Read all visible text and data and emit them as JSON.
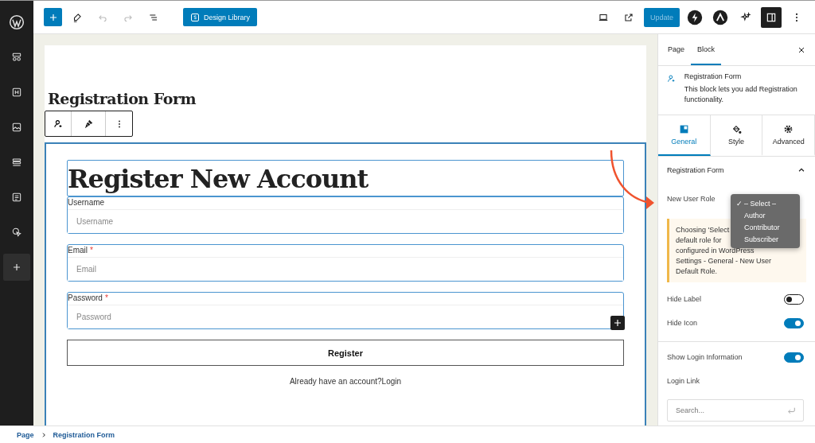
{
  "toolbar": {
    "design_library": "Design Library",
    "update": "Update"
  },
  "sidebar_items": [
    {
      "selected": false
    },
    {
      "selected": false
    },
    {
      "selected": false
    },
    {
      "selected": false
    },
    {
      "selected": false
    },
    {
      "selected": false
    },
    {
      "selected": false
    },
    {
      "selected": true
    }
  ],
  "canvas": {
    "page_title": "Registration Form",
    "heading": "Register New Account",
    "fields": [
      {
        "label": "Username",
        "placeholder": "Username"
      },
      {
        "label": "Email",
        "mark": "*",
        "placeholder": "Email"
      },
      {
        "label": "Password",
        "mark": "*",
        "placeholder": "Password"
      }
    ],
    "button": "Register",
    "login_prompt": "Already have an account?Login"
  },
  "breadcrumb": [
    "Page",
    "Registration Form"
  ],
  "panel": {
    "tabs": [
      {
        "label": "Page",
        "selected": false
      },
      {
        "label": "Block",
        "selected": true
      }
    ],
    "block": {
      "title": "Registration Form",
      "description": "This block lets you add Registration functionality."
    },
    "subtabs": [
      {
        "label": "General",
        "selected": true
      },
      {
        "label": "Style",
        "selected": false
      },
      {
        "label": "Advanced",
        "selected": false
      }
    ],
    "section": {
      "title": "Registration Form",
      "expanded": true
    },
    "role_label": "New User Role",
    "check_mark": "✓",
    "role_options": [
      {
        "label": "– Select –",
        "selected": true
      },
      {
        "label": "Author",
        "selected": false
      },
      {
        "label": "Contributor",
        "selected": false
      },
      {
        "label": "Subscriber",
        "selected": false
      }
    ],
    "notice": [
      "Choosing 'Select",
      "default role for",
      "configured in WordPress",
      "Settings - General - New User",
      "Default Role."
    ],
    "toggle_groups": [
      [
        {
          "label": "Hide Label",
          "on": false
        },
        {
          "label": "Hide Icon",
          "on": true
        }
      ],
      [
        {
          "label": "Show Login Information",
          "on": true
        }
      ]
    ],
    "login_link": {
      "label": "Login Link",
      "placeholder": "Search..."
    }
  }
}
